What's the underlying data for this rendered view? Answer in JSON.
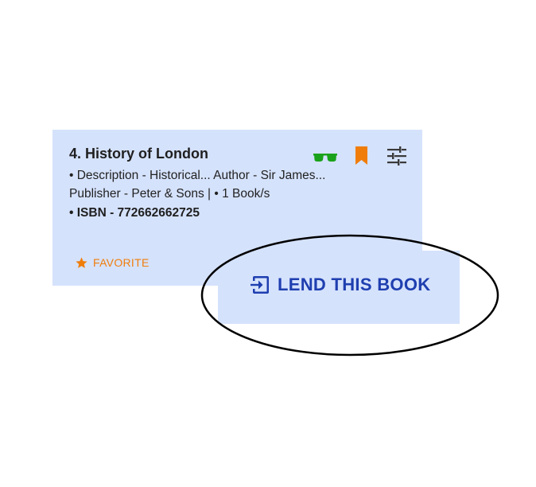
{
  "book": {
    "title": "4. History of London",
    "description": "• Description - Historical... Author - Sir James... Publisher - Peter & Sons | • 1 Book/s",
    "isbn": "• ISBN - 772662662725"
  },
  "actions": {
    "favorite_label": "FAVORITE",
    "lend_label": "LEND THIS BOOK"
  },
  "icons": {
    "top_right": [
      "glasses-icon",
      "bookmark-icon",
      "tune-icon"
    ],
    "favorite": "star-icon",
    "lend": "login-arrow-icon"
  },
  "colors": {
    "card_bg": "#d5e2fc",
    "accent_orange": "#f07d0a",
    "accent_green": "#1aa21a",
    "accent_blue": "#1f3fb0"
  }
}
